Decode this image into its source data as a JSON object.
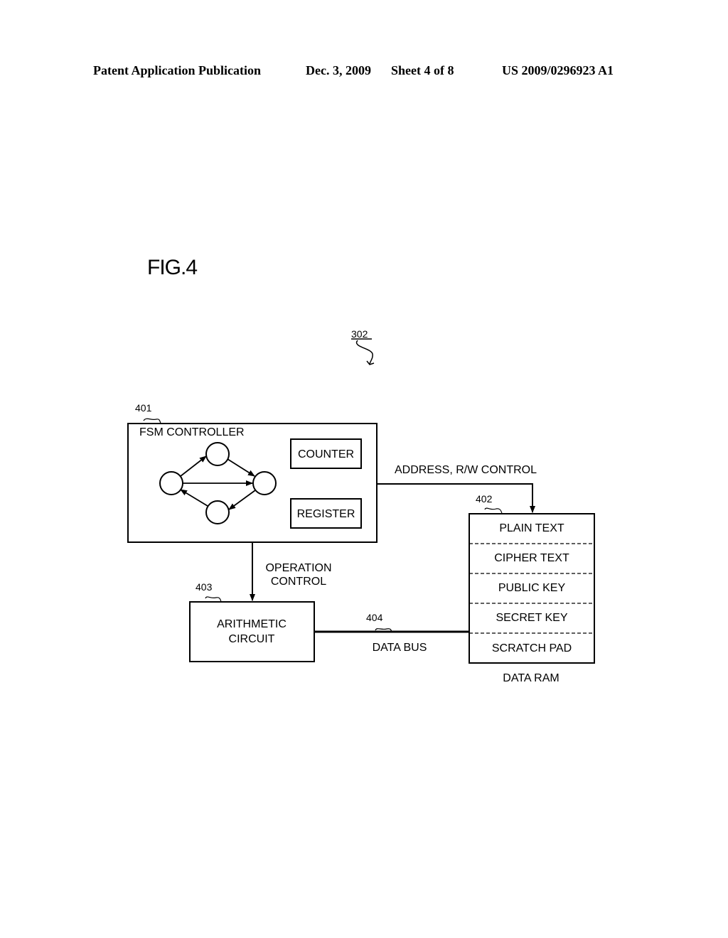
{
  "header": {
    "publication": "Patent Application Publication",
    "date": "Dec. 3, 2009",
    "sheet": "Sheet 4 of 8",
    "patent_number": "US 2009/0296923 A1"
  },
  "figure": {
    "title": "FIG.4",
    "ref_overall": "302"
  },
  "blocks": {
    "fsm_controller": {
      "ref": "401",
      "label": "FSM CONTROLLER",
      "counter": "COUNTER",
      "register": "REGISTER"
    },
    "data_ram": {
      "ref": "402",
      "label": "DATA RAM",
      "rows": [
        "PLAIN TEXT",
        "CIPHER TEXT",
        "PUBLIC KEY",
        "SECRET KEY",
        "SCRATCH PAD"
      ]
    },
    "arithmetic_circuit": {
      "ref": "403",
      "label_line1": "ARITHMETIC",
      "label_line2": "CIRCUIT"
    },
    "data_bus": {
      "ref": "404",
      "label": "DATA BUS"
    }
  },
  "connections": {
    "address_rw": "ADDRESS, R/W CONTROL",
    "operation_control_line1": "OPERATION",
    "operation_control_line2": "CONTROL"
  }
}
